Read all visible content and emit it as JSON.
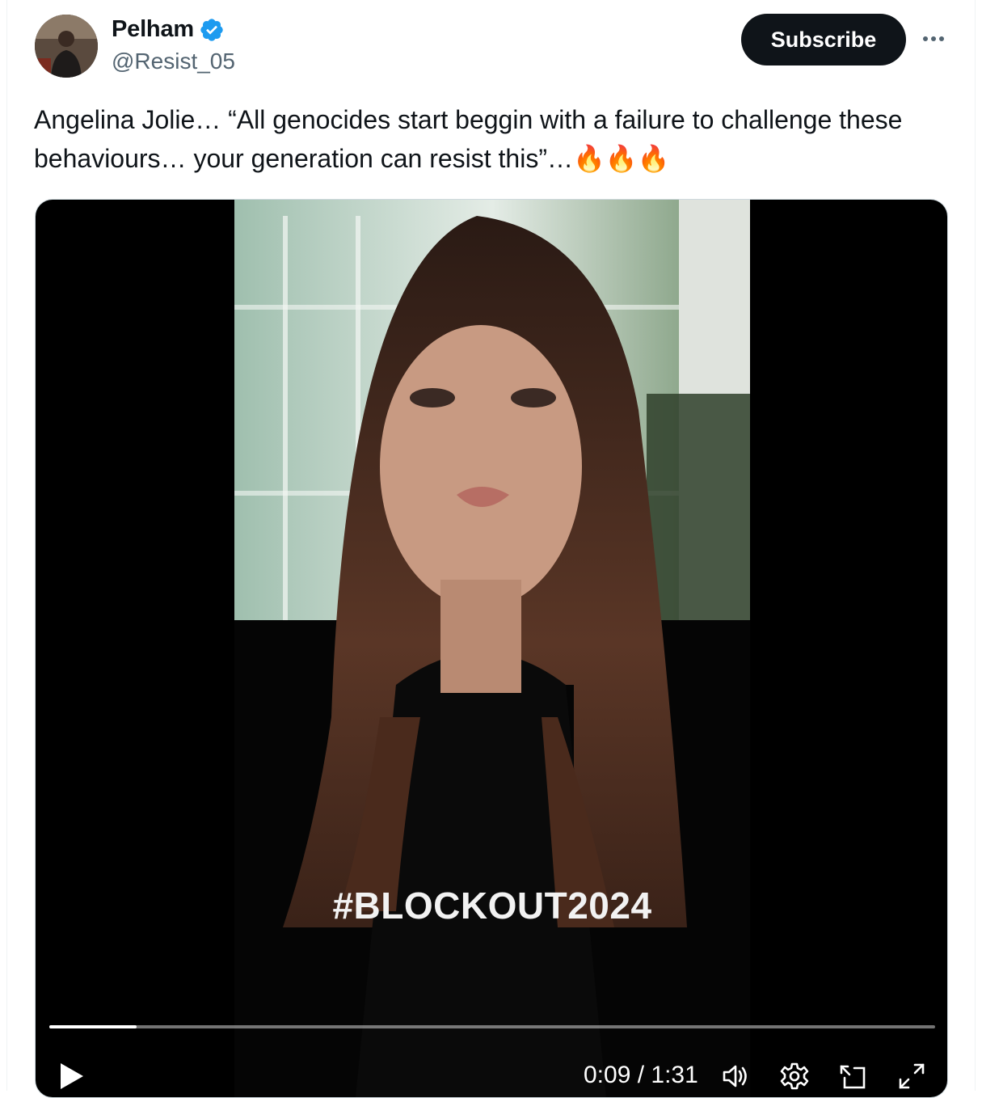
{
  "author": {
    "display_name": "Pelham",
    "handle": "@Resist_05",
    "verified": true
  },
  "actions": {
    "subscribe_label": "Subscribe",
    "more_icon": "more-horizontal-icon"
  },
  "tweet": {
    "text": "Angelina Jolie… “All genocides start beggin with a failure to challenge these behaviours… your generation can resist this”…",
    "emoji": "🔥🔥🔥"
  },
  "video": {
    "overlay_text": "#BLOCKOUT2024",
    "progress": 0.0989,
    "time_current": "0:09",
    "time_total": "1:31",
    "time_separator": " / ",
    "controls": [
      "play-icon",
      "volume-icon",
      "settings-icon",
      "picture-in-picture-icon",
      "fullscreen-icon"
    ]
  },
  "colors": {
    "accent": "#1d9bf0",
    "button_bg": "#0f1419",
    "secondary_text": "#536471"
  }
}
